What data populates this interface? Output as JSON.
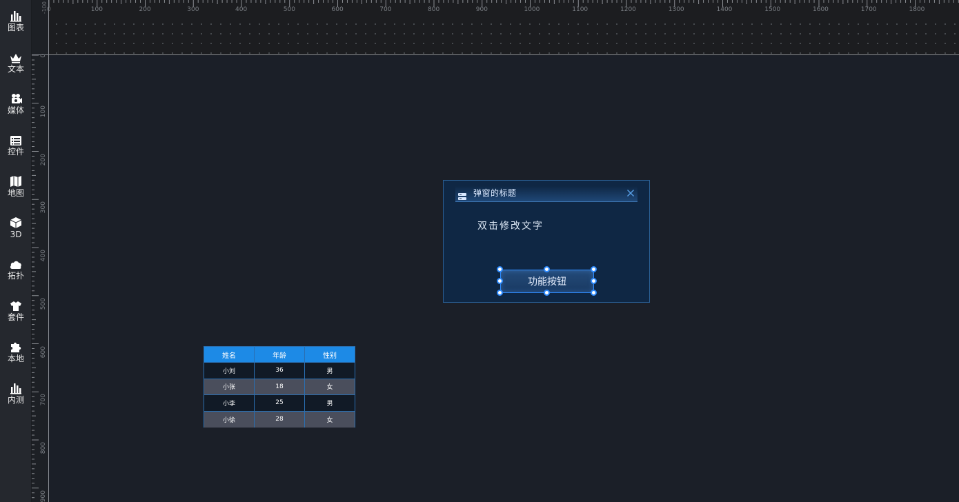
{
  "sidebar": {
    "items": [
      {
        "label": "图表",
        "icon": "bar-chart-icon"
      },
      {
        "label": "文本",
        "icon": "crown-text-icon"
      },
      {
        "label": "媒体",
        "icon": "video-camera-icon"
      },
      {
        "label": "控件",
        "icon": "widget-list-icon"
      },
      {
        "label": "地图",
        "icon": "map-icon"
      },
      {
        "label": "3D",
        "icon": "cube-icon"
      },
      {
        "label": "拓扑",
        "icon": "cloud-topology-icon"
      },
      {
        "label": "套件",
        "icon": "tshirt-kit-icon"
      },
      {
        "label": "本地",
        "icon": "puzzle-icon"
      },
      {
        "label": "内测",
        "icon": "bar-chart-beta-icon"
      }
    ]
  },
  "ruler": {
    "horizontal_labels": [
      "0",
      "100",
      "200",
      "300",
      "400",
      "500",
      "600",
      "700",
      "800",
      "900",
      "1000",
      "1100",
      "1200",
      "1300",
      "1400",
      "1500",
      "1600",
      "1700",
      "1800"
    ],
    "vertical_labels": [
      "0",
      "100",
      "200",
      "300",
      "400",
      "500",
      "600",
      "700",
      "800",
      "900"
    ],
    "top_left_value": "-100"
  },
  "popup": {
    "title": "弹窗的标题",
    "body_text": "双击修改文字",
    "button_label": "功能按钮"
  },
  "table": {
    "headers": [
      "姓名",
      "年龄",
      "性别"
    ],
    "rows": [
      [
        "小刘",
        "36",
        "男"
      ],
      [
        "小张",
        "18",
        "女"
      ],
      [
        "小李",
        "25",
        "男"
      ],
      [
        "小徐",
        "28",
        "女"
      ]
    ]
  },
  "colors": {
    "accent": "#1d8ae6",
    "selection": "#2f8cff",
    "popup_bg": "#0f2744",
    "canvas_bg": "#1b1f28"
  }
}
